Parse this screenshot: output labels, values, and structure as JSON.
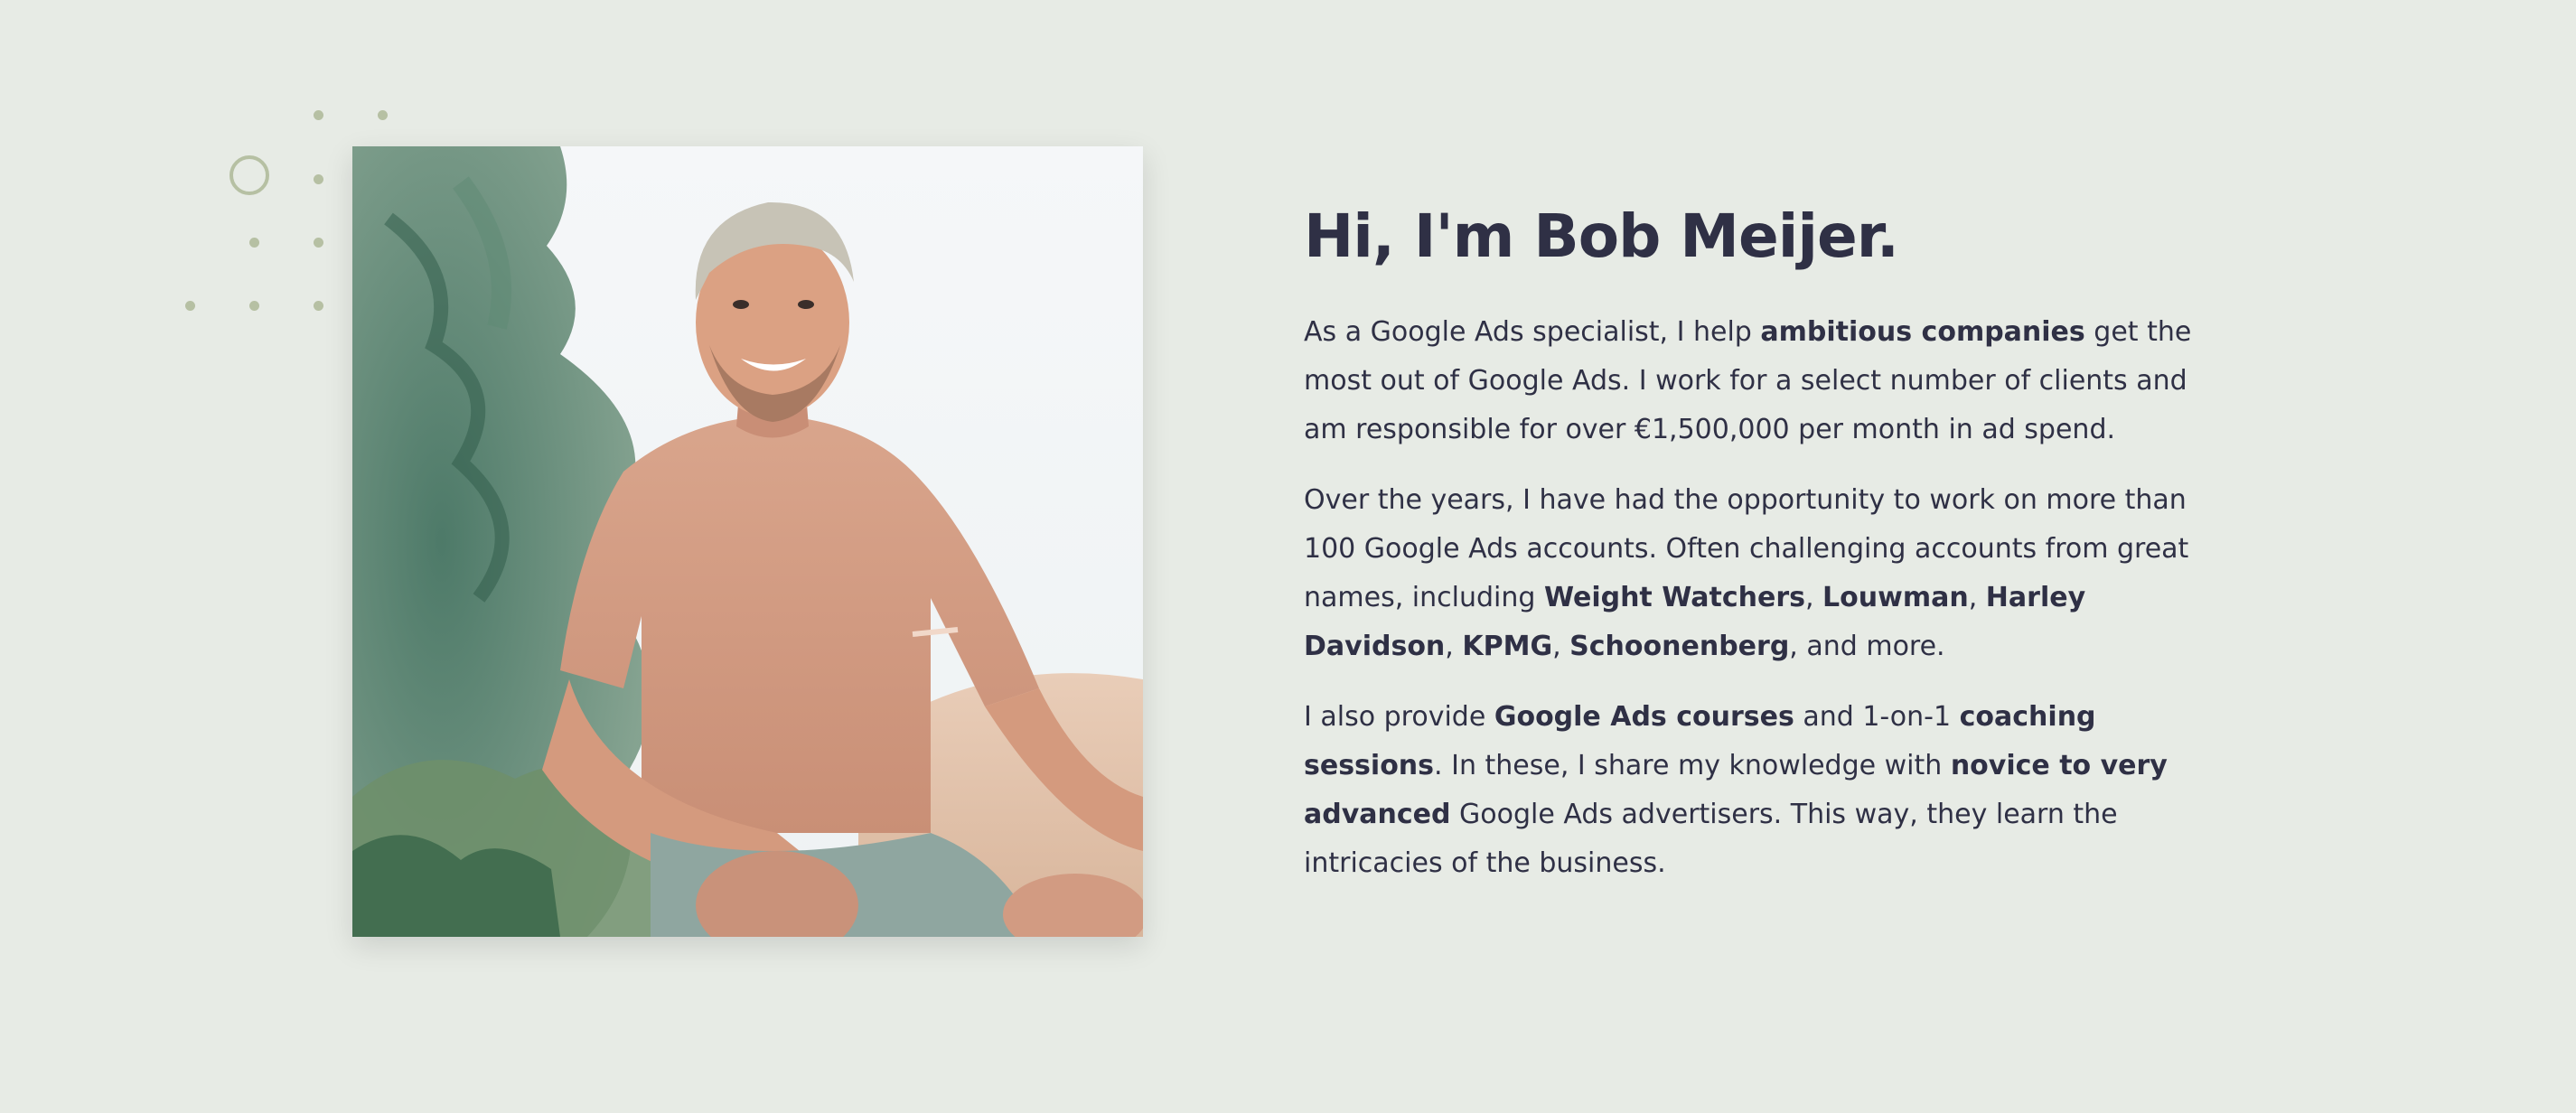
{
  "colors": {
    "background": "#e7ebe5",
    "text": "#2f3045",
    "decoration": "#b6c0a3"
  },
  "hero": {
    "title": "Hi, I'm Bob Meijer.",
    "photo_icon": "portrait-photo",
    "paragraph1": {
      "t1": "As a Google Ads specialist, I help ",
      "b1": "ambitious companies",
      "t2": " get the most out of Google Ads. I work for a select number of clients and am responsible for over €1,500,000 per month in ad spend."
    },
    "paragraph2": {
      "t1": "Over the years, I have had the opportunity to work on more than 100 Google Ads accounts. Often challenging accounts from great names, including ",
      "b1": "Weight Watchers",
      "s1": ", ",
      "b2": "Louwman",
      "s2": ", ",
      "b3": "Harley Davidson",
      "s3": ", ",
      "b4": "KPMG",
      "s4": ", ",
      "b5": "Schoonenberg",
      "t2": ", and more."
    },
    "paragraph3": {
      "t1": "I also provide ",
      "b1": "Google Ads courses",
      "t2": " and 1-on-1 ",
      "b2": "coaching sessions",
      "t3": ". In these, I share my knowledge with ",
      "b3": "novice to very advanced",
      "t4": " Google Ads advertisers. This way, they learn the intricacies of the business."
    }
  }
}
